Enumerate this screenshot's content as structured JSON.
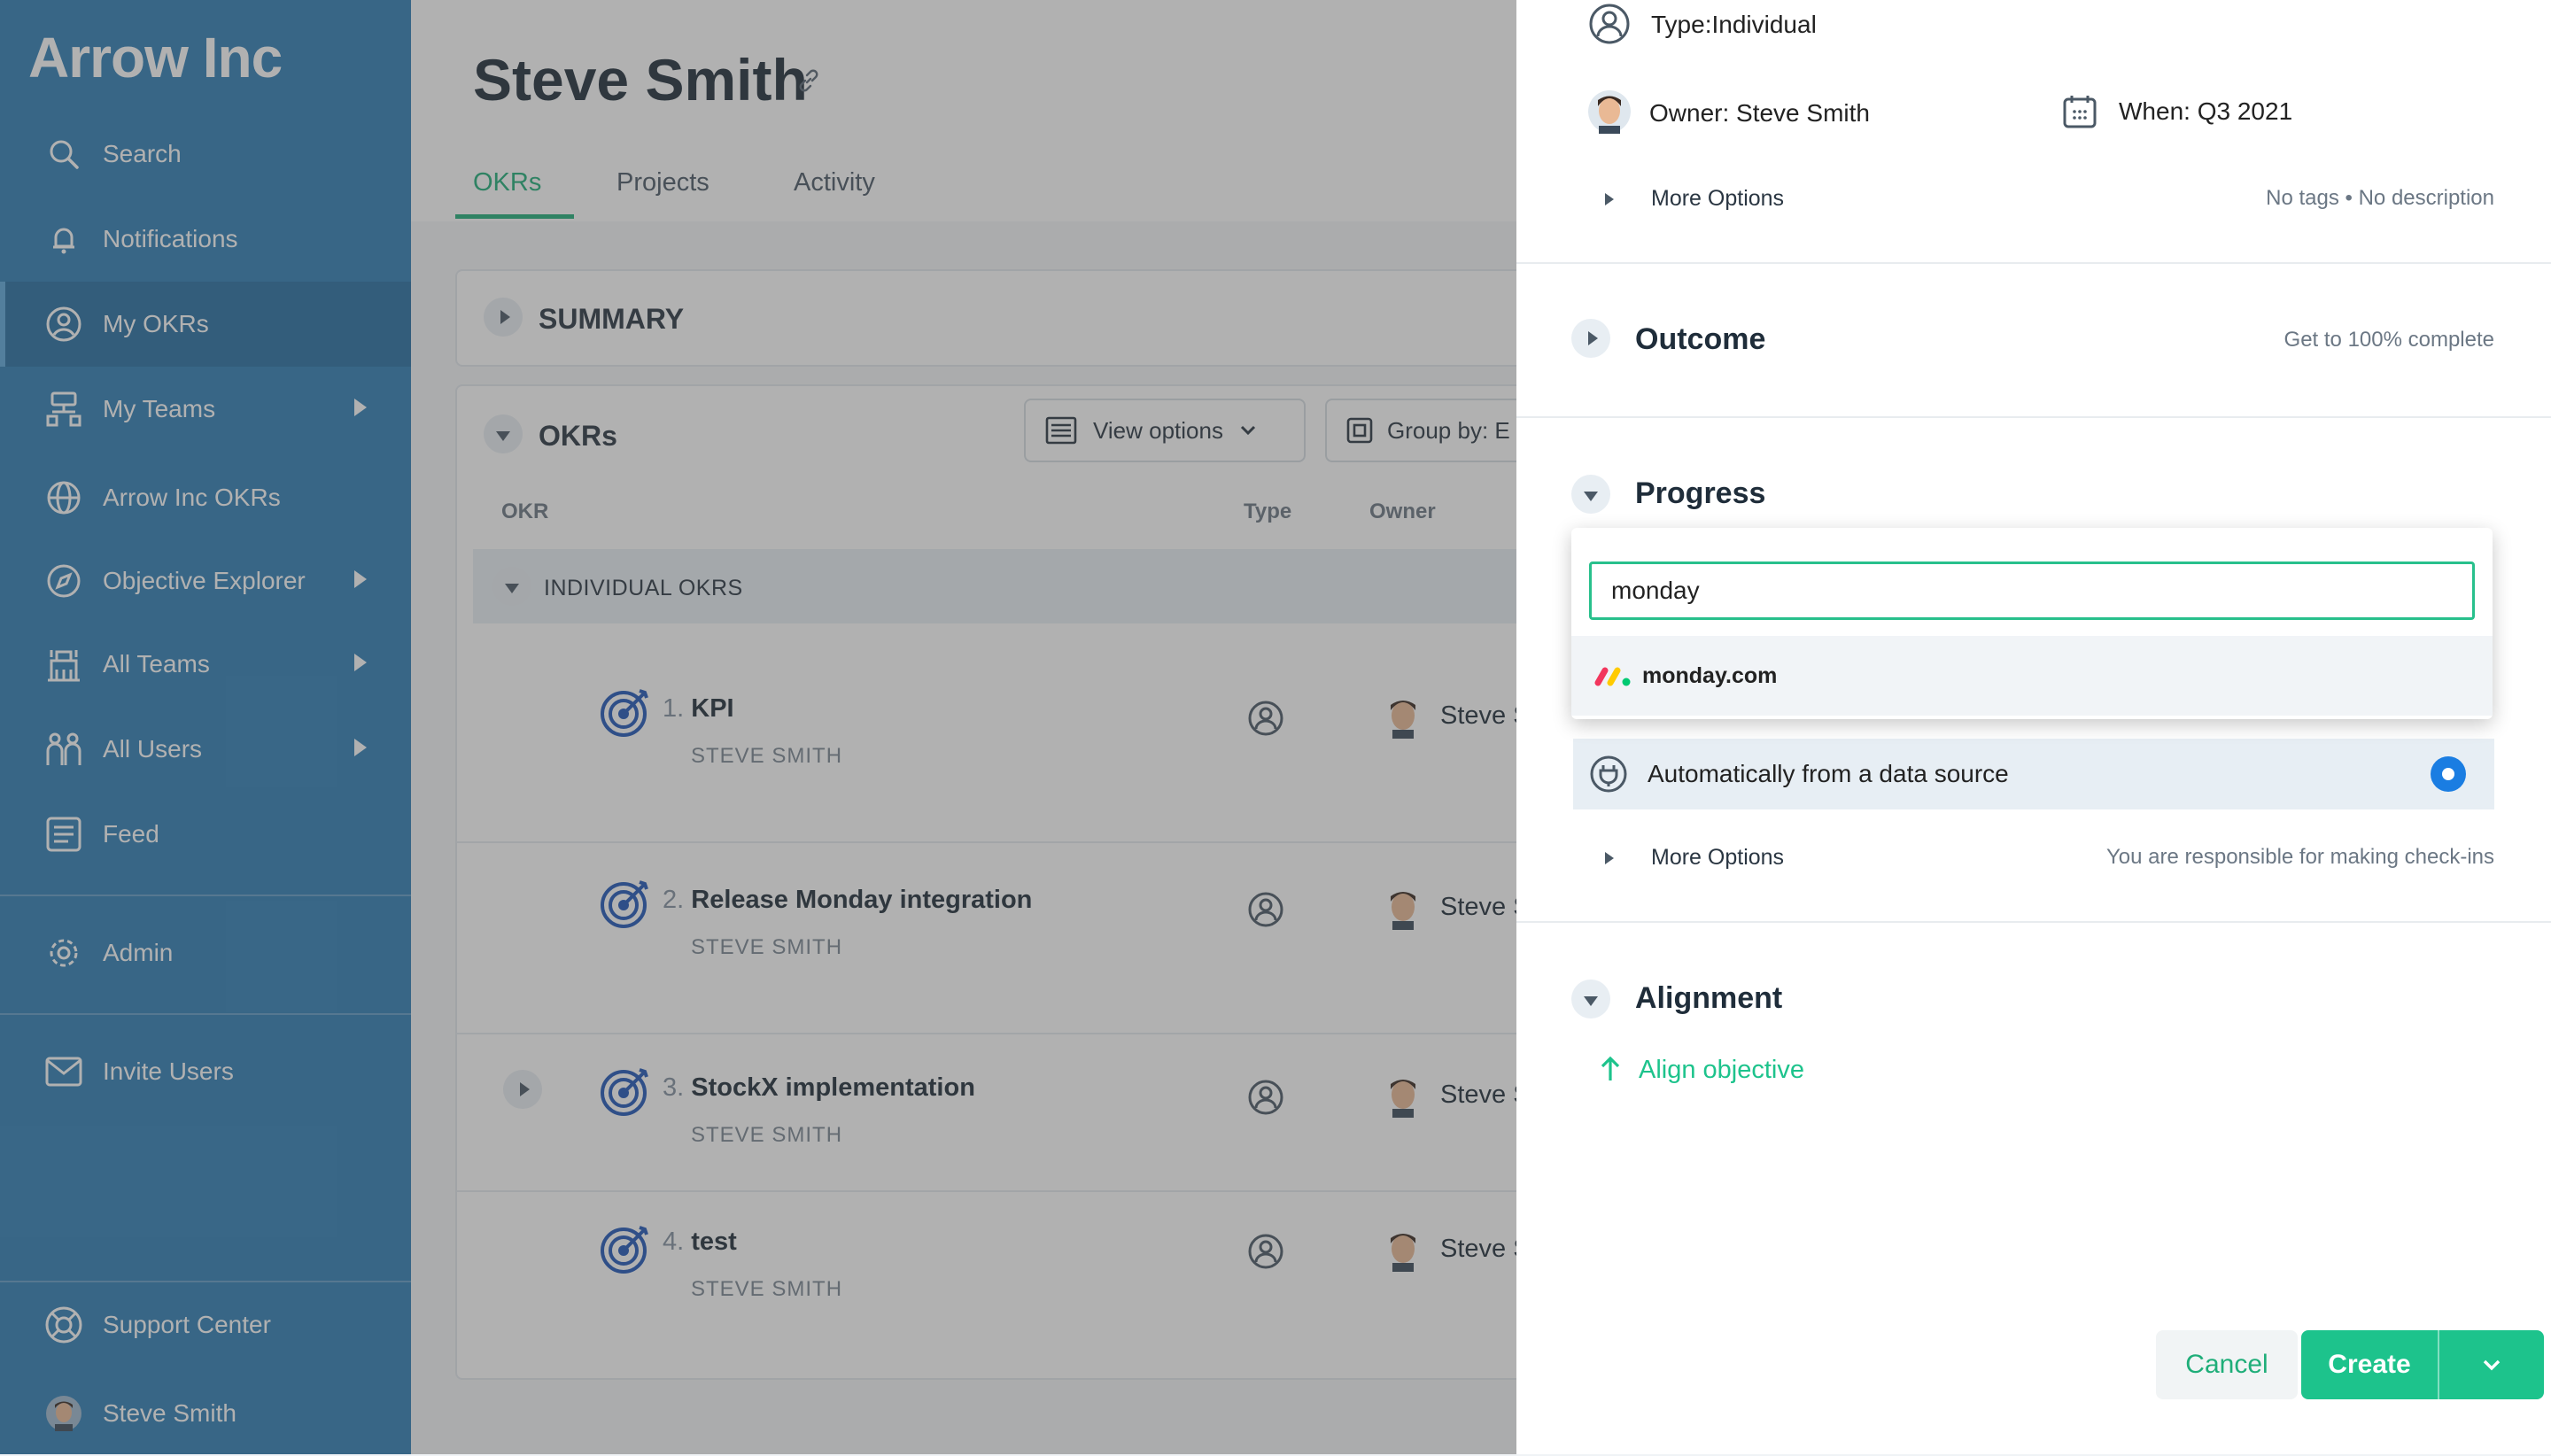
{
  "sidebar": {
    "brand": "Arrow Inc",
    "items": [
      {
        "label": "Search",
        "icon": "search-icon"
      },
      {
        "label": "Notifications",
        "icon": "bell-icon"
      },
      {
        "label": "My OKRs",
        "icon": "user-circle-icon",
        "active": true
      },
      {
        "label": "My Teams",
        "icon": "team-tree-icon",
        "expandable": true
      },
      {
        "label": "Arrow Inc OKRs",
        "icon": "globe-icon"
      },
      {
        "label": "Objective Explorer",
        "icon": "compass-icon",
        "expandable": true
      },
      {
        "label": "All Teams",
        "icon": "building-icon",
        "expandable": true
      },
      {
        "label": "All Users",
        "icon": "users-icon",
        "expandable": true
      },
      {
        "label": "Feed",
        "icon": "feed-icon"
      },
      {
        "label": "Admin",
        "icon": "gear-icon"
      },
      {
        "label": "Invite Users",
        "icon": "mail-icon"
      },
      {
        "label": "Support Center",
        "icon": "lifebuoy-icon"
      },
      {
        "label": "Steve Smith",
        "icon": "avatar"
      }
    ]
  },
  "page": {
    "title": "Steve Smith",
    "tabs": [
      "OKRs",
      "Projects",
      "Activity"
    ],
    "active_tab": "OKRs",
    "summary_title": "SUMMARY",
    "okrs_title": "OKRs",
    "view_options": "View options",
    "group_by": "Group by: E",
    "columns": {
      "okr": "OKR",
      "type": "Type",
      "owner": "Owner"
    },
    "group_label": "INDIVIDUAL OKRS",
    "okrs": [
      {
        "num": "1.",
        "title": "KPI",
        "sub": "STEVE SMITH",
        "owner": "Steve Smit"
      },
      {
        "num": "2.",
        "title": "Release Monday integration",
        "sub": "STEVE SMITH",
        "owner": "Steve Smit"
      },
      {
        "num": "3.",
        "title": "StockX implementation",
        "sub": "STEVE SMITH",
        "owner": "Steve Smit"
      },
      {
        "num": "4.",
        "title": "test",
        "sub": "STEVE SMITH",
        "owner": "Steve Smit"
      }
    ]
  },
  "panel": {
    "type_label": "Type:",
    "type_value": "Individual",
    "owner_label": "Owner:",
    "owner_value": "Steve Smith",
    "when_label": "When:",
    "when_value": "Q3 2021",
    "more_options_1": "More Options",
    "tags_info": "No tags • No description",
    "outcome_title": "Outcome",
    "outcome_info": "Get to 100% complete",
    "progress_title": "Progress",
    "search_value": "monday",
    "dropdown_option": "monday.com",
    "auto_source": "Automatically from a data source",
    "more_options_2": "More Options",
    "checkin_info": "You are responsible for making check-ins",
    "alignment_title": "Alignment",
    "align_link": "Align objective",
    "cancel": "Cancel",
    "create": "Create"
  },
  "colors": {
    "sidebar": "#2f7eb6",
    "accent_green": "#1dc38c",
    "radio_blue": "#1a7de2"
  }
}
